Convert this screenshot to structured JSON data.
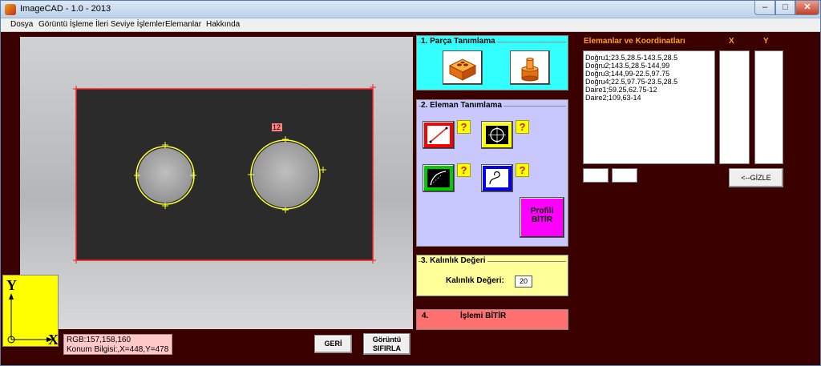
{
  "window": {
    "title": "ImageCAD - 1.0 - 2013",
    "min": "‒",
    "max": "□",
    "close": "✕"
  },
  "menu": [
    {
      "label": "Dosya"
    },
    {
      "label": "Görüntü İşleme"
    },
    {
      "label": "İleri Seviye İşlemler"
    },
    {
      "label": "Elemanlar"
    },
    {
      "label": "Hakkında"
    }
  ],
  "image_view": {
    "marker_label": "12"
  },
  "axis": {
    "y": "Y",
    "x": "X"
  },
  "info": {
    "rgb": "RGB:157,158,160",
    "position": "Konum Bilgisi:,X=448,Y=478"
  },
  "buttons": {
    "back": "GERİ",
    "reset_line1": "Görüntü",
    "reset_line2": "SIFIRLA"
  },
  "panel1": {
    "title": "1. Parça Tanımlama"
  },
  "panel2": {
    "title": "2. Eleman Tanımlama",
    "qmark": "?",
    "finish_profile_line1": "Profili",
    "finish_profile_line2": "BİTİR"
  },
  "panel3": {
    "title": "3. Kalınlık Değeri",
    "label": "Kalınlık Değeri:",
    "value": "20"
  },
  "panel4": {
    "title": "4.",
    "label": "İşlemi BİTİR"
  },
  "elements": {
    "header": "Elemanlar ve Koordinatları",
    "x_header": "X",
    "y_header": "Y",
    "items": [
      "Doğru1;23.5,28.5-143.5,28.5",
      "Doğru2;143.5,28.5-144,99",
      "Doğru3;144,99-22.5,97.75",
      "Doğru4;22.5,97.75-23.5,28.5",
      "Daire1;59.25,62.75-12",
      "Daire2;109,63-14"
    ],
    "hide_button": "<--GİZLE"
  },
  "colors": {
    "background": "#3a0000",
    "panel1": "#33ffff",
    "panel2": "#c8c8ff",
    "panel3": "#ffff99",
    "panel4": "#ff7070",
    "accent": "#ffa020"
  }
}
